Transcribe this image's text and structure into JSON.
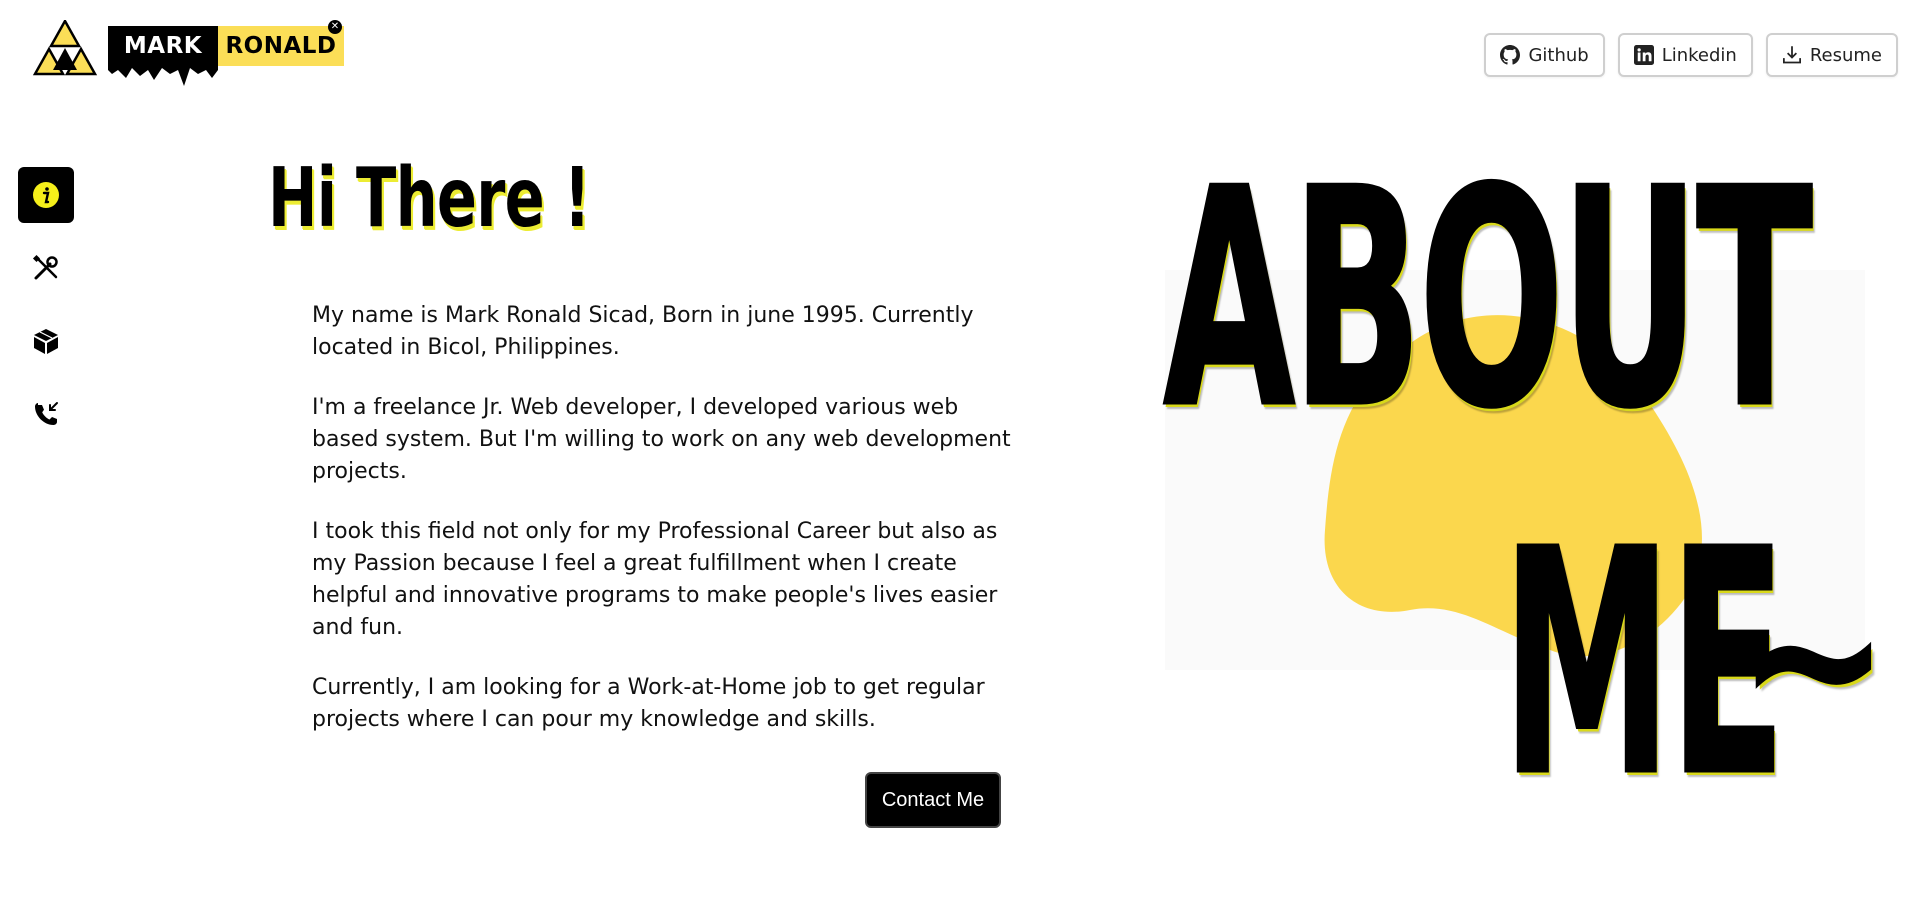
{
  "logo": {
    "part1": "MARK",
    "part2": "RONALD",
    "close_glyph": "✕",
    "colors": {
      "yellow": "#fbde57",
      "black": "#000000"
    }
  },
  "top_nav": {
    "github_label": "Github",
    "linkedin_label": "Linkedin",
    "resume_label": "Resume",
    "icons": [
      "github-icon",
      "linkedin-icon",
      "download-icon"
    ]
  },
  "sidebar": {
    "items": [
      {
        "name": "about",
        "icon": "info-icon",
        "active": true
      },
      {
        "name": "skills",
        "icon": "tools-icon",
        "active": false
      },
      {
        "name": "projects",
        "icon": "box-icon",
        "active": false
      },
      {
        "name": "contact",
        "icon": "phone-icon",
        "active": false
      }
    ]
  },
  "main": {
    "greeting": "Hi There !",
    "paragraphs": [
      "My name is Mark Ronald Sicad, Born in june 1995. Currently located in Bicol, Philippines.",
      "I'm a freelance Jr. Web developer, I developed various web based system. But I'm willing to work on any web development projects.",
      "I took this field not only for my Professional Career but also as my Passion because I feel a great fulfillment when I create helpful and innovative programs to make people's lives easier and fun.",
      "Currently, I am looking for a Work-at-Home job to get regular projects where I can pour my knowledge and skills."
    ],
    "contact_button": "Contact Me"
  },
  "art": {
    "word1": "ABOUT",
    "word2": "ME",
    "word3": "~",
    "accent_color": "#fbd74d",
    "shadow_color": "#d9d91a"
  }
}
